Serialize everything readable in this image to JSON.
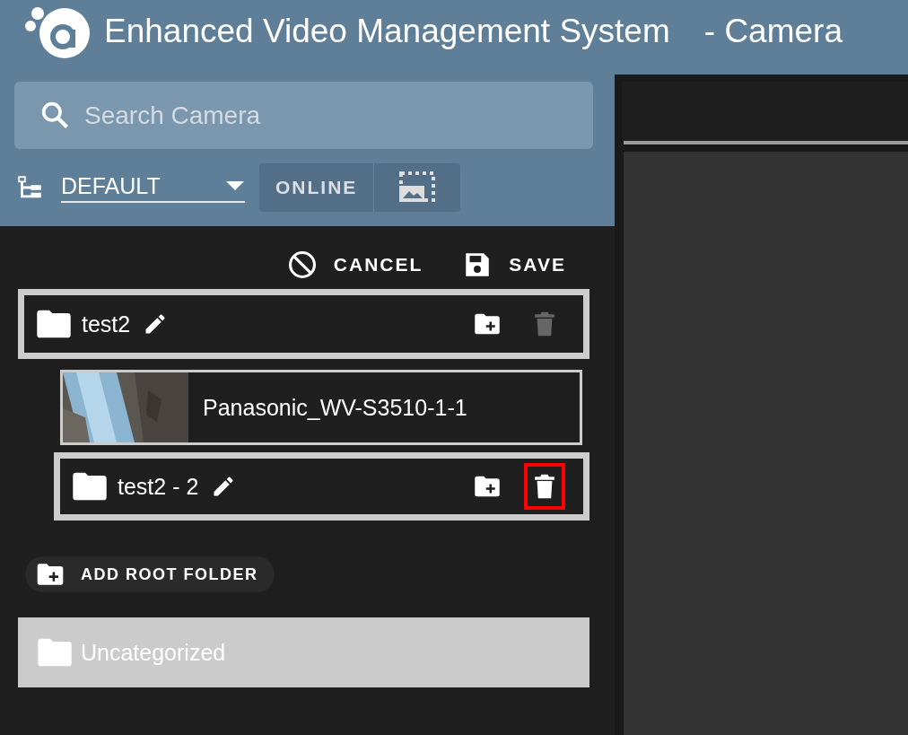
{
  "header": {
    "title": "Enhanced Video Management System",
    "subtitle": "- Camera"
  },
  "search": {
    "placeholder": "Search Camera"
  },
  "group_select": {
    "value": "DEFAULT"
  },
  "filters": [
    {
      "kind": "text",
      "label": "ONLINE",
      "selected": false
    },
    {
      "kind": "thumbnail",
      "selected": false
    }
  ],
  "actions": [
    {
      "kind": "cancel",
      "label": "CANCEL"
    },
    {
      "kind": "save",
      "label": "SAVE"
    }
  ],
  "tree": [
    {
      "kind": "folder",
      "name": "test2",
      "delete_enabled": false,
      "highlighted": false,
      "children": [
        {
          "kind": "camera",
          "name": "Panasonic_WV-S3510-1-1"
        },
        {
          "kind": "folder",
          "name": "test2 - 2",
          "delete_enabled": true,
          "highlighted": true
        }
      ]
    }
  ],
  "add_root": {
    "label": "ADD ROOT FOLDER"
  },
  "uncategorized": {
    "label": "Uncategorized"
  }
}
